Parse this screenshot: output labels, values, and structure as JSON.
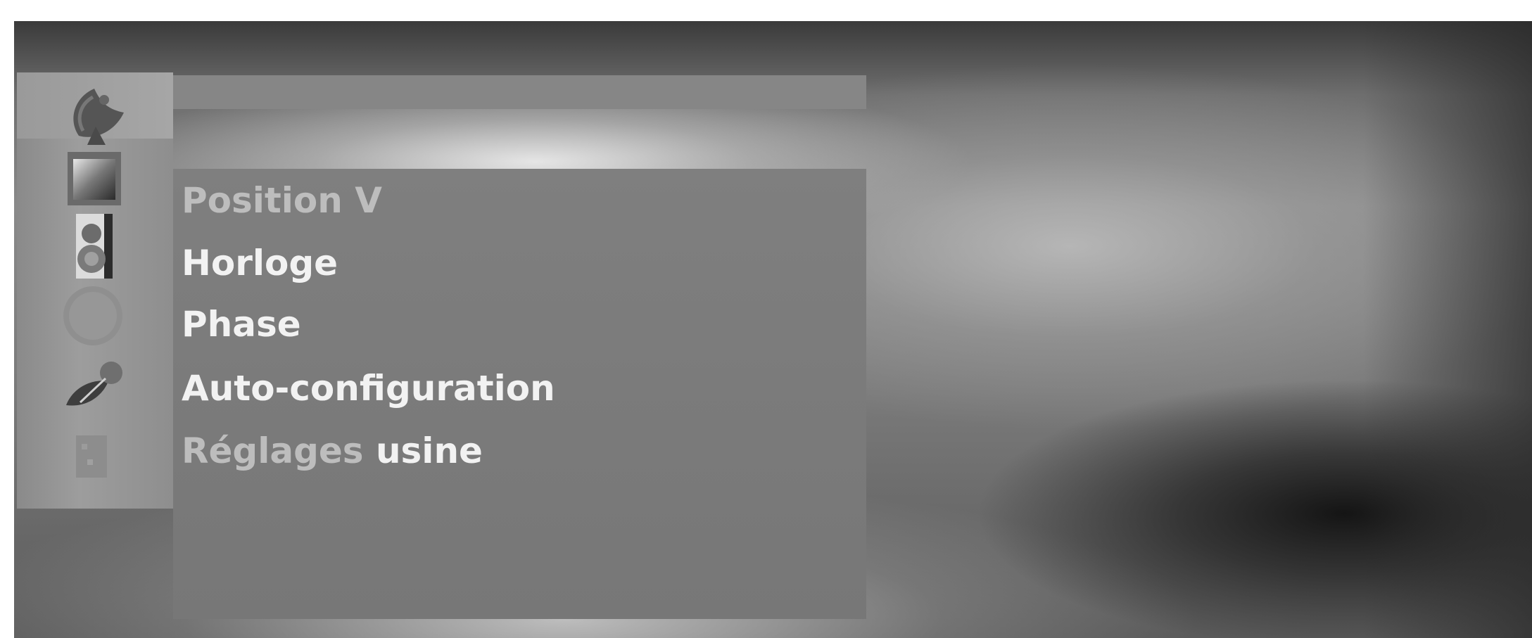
{
  "osd_menu": {
    "title": "",
    "items": [
      {
        "label": "Position V",
        "style": "dim"
      },
      {
        "label": "Horloge",
        "style": "bright"
      },
      {
        "label": "Phase",
        "style": "bright"
      },
      {
        "label": "Auto-configuration",
        "style": "bright"
      },
      {
        "label_part1": "Réglages",
        "label_part2": " usine",
        "style": "mixed"
      }
    ]
  },
  "sidebar": {
    "icons": [
      "satellite-dish-icon",
      "picture-icon",
      "speaker-icon",
      "clock-icon",
      "special-icon",
      "screen-icon"
    ]
  },
  "colors": {
    "panel": "#7f7f7f",
    "text_bright": "#f2f2f2",
    "text_dim": "#bdbdbd",
    "sidebar": "#9a9a9a"
  }
}
